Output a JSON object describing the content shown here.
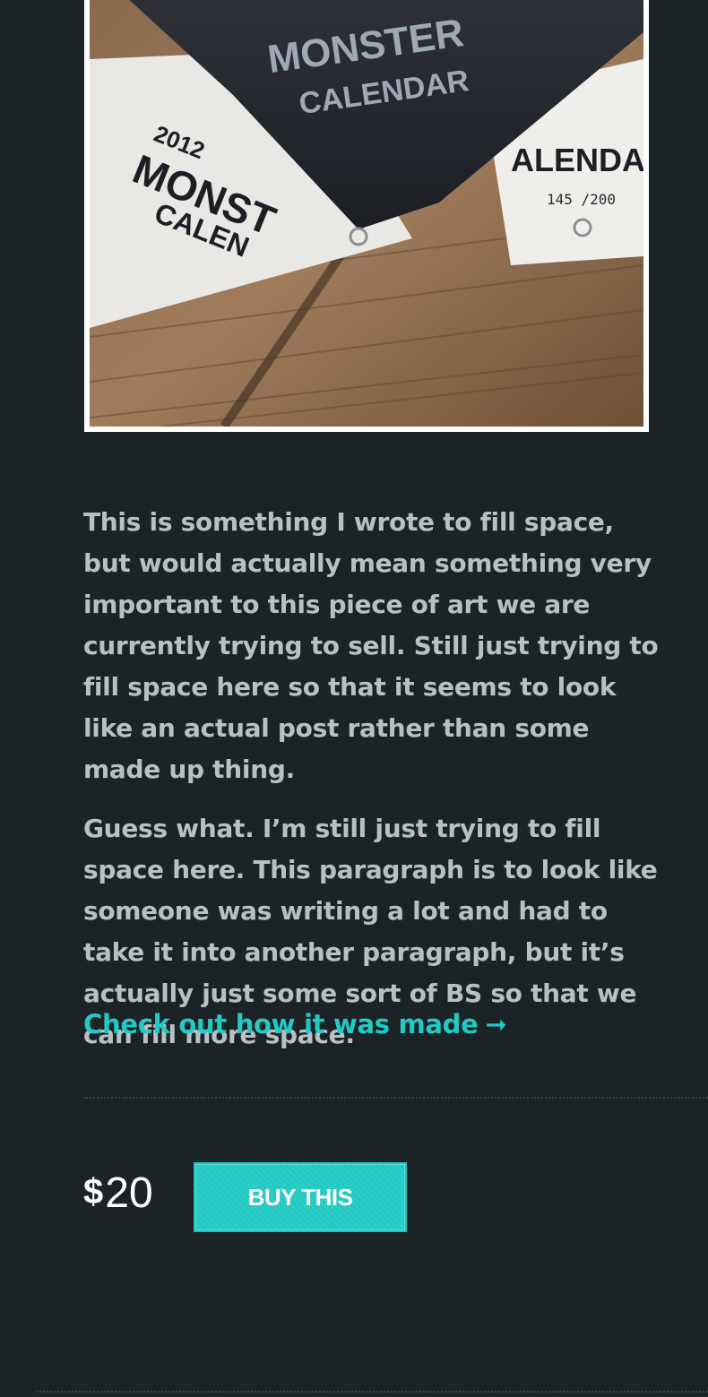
{
  "product": {
    "image_alt": "2012 Monster Calendar"
  },
  "description": {
    "paragraphs": [
      "This is something I wrote to fill space, but would actually mean something very important to this piece of art we are currently trying to sell. Still just trying to fill space here so that it seems to look like an actual post rather than some made up thing.",
      "Guess what. I’m still just trying to fill space here. This paragraph is to look like someone was writing a lot and had to take it into another paragraph, but it’s actually just some sort of BS so that we can fill more space."
    ]
  },
  "made_link": {
    "label": "Check out how it was made",
    "arrow": "➞"
  },
  "purchase": {
    "currency": "$",
    "amount": "20",
    "button_label": "BUY THIS"
  },
  "photo_text": {
    "envelope_line1": "MONSTER",
    "envelope_line2": "CALENDAR",
    "left_card_year": "2012",
    "left_card_line1": "MONST",
    "left_card_line2": "CALEN",
    "right_card_line": "ALENDA",
    "right_card_edition": "145 /200"
  },
  "colors": {
    "background": "#1b2326",
    "body_text": "#b9c0c3",
    "accent": "#23c9c3",
    "price": "#ffffff"
  }
}
